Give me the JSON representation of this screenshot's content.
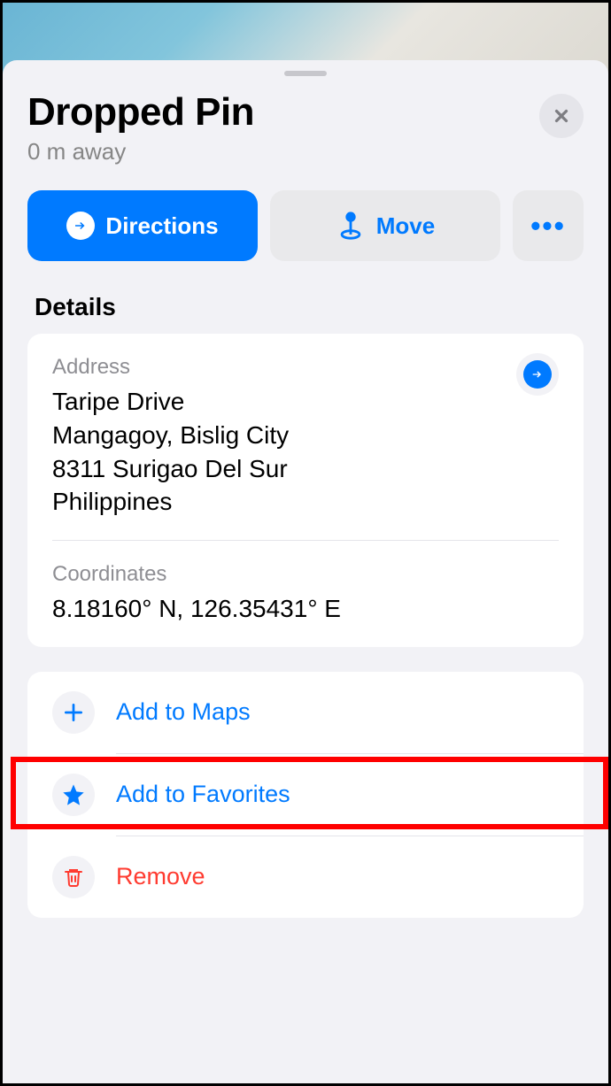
{
  "header": {
    "title": "Dropped Pin",
    "subtitle": "0 m away"
  },
  "actions": {
    "directions": "Directions",
    "move": "Move",
    "more": "•••"
  },
  "details": {
    "section_title": "Details",
    "address_label": "Address",
    "address_lines": [
      "Taripe Drive",
      "Mangagoy, Bislig City",
      "8311 Surigao Del Sur",
      "Philippines"
    ],
    "coordinates_label": "Coordinates",
    "coordinates": "8.18160° N, 126.35431° E"
  },
  "list": {
    "add_to_maps": "Add to Maps",
    "add_to_favorites": "Add to Favorites",
    "remove": "Remove"
  }
}
